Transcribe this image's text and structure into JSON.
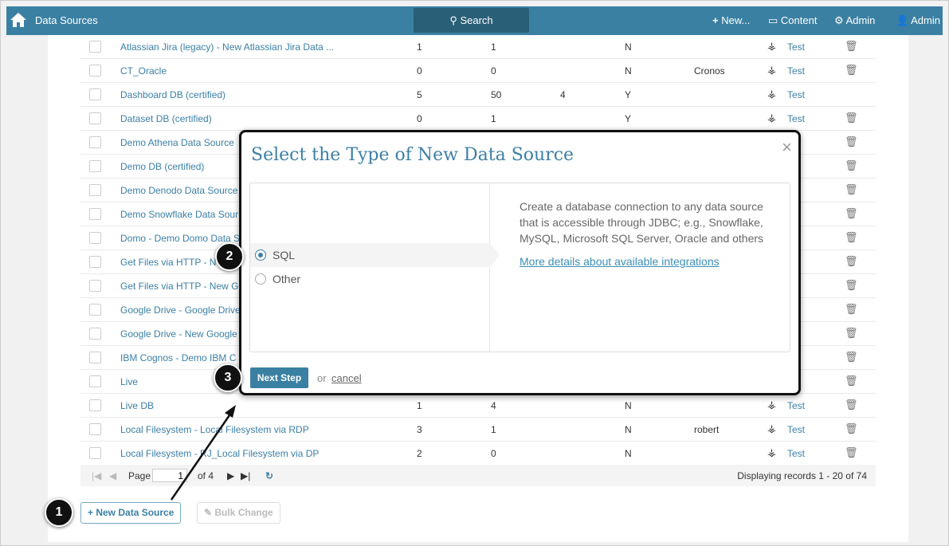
{
  "header": {
    "title": "Data Sources",
    "search": "Search",
    "new": "New...",
    "content": "Content",
    "admin_settings": "Admin",
    "user": "Admin"
  },
  "rows": [
    {
      "name": "Atlassian Jira (legacy) - New Atlassian Jira Data ...",
      "c1": "1",
      "c2": "1",
      "c3": "",
      "c4": "N",
      "c5": "",
      "test": "Test",
      "trash": true
    },
    {
      "name": "CT_Oracle",
      "c1": "0",
      "c2": "0",
      "c3": "",
      "c4": "N",
      "c5": "Cronos",
      "test": "Test",
      "trash": true
    },
    {
      "name": "Dashboard DB (certified)",
      "c1": "5",
      "c2": "50",
      "c3": "4",
      "c4": "Y",
      "c5": "",
      "test": "Test",
      "trash": false
    },
    {
      "name": "Dataset DB (certified)",
      "c1": "0",
      "c2": "1",
      "c3": "",
      "c4": "Y",
      "c5": "",
      "test": "Test",
      "trash": true
    },
    {
      "name": "Demo Athena Data Source",
      "trash": true
    },
    {
      "name": "Demo DB (certified)",
      "trash": true
    },
    {
      "name": "Demo Denodo Data Source",
      "trash": true
    },
    {
      "name": "Demo Snowflake Data Sour",
      "trash": true
    },
    {
      "name": "Domo - Demo Domo Data S",
      "trash": true
    },
    {
      "name": "Get Files via HTTP - N",
      "trash": true
    },
    {
      "name": "Get Files via HTTP - New G",
      "trash": true
    },
    {
      "name": "Google Drive - Google Drive",
      "trash": true
    },
    {
      "name": "Google Drive - New Google",
      "trash": true
    },
    {
      "name": "IBM Cognos - Demo IBM C",
      "trash": true
    },
    {
      "name": "Live",
      "trash": true
    },
    {
      "name": "Live DB",
      "c1": "1",
      "c2": "4",
      "c3": "",
      "c4": "N",
      "c5": "",
      "test": "Test",
      "trash": true
    },
    {
      "name": "Local Filesystem - Local Filesystem via RDP",
      "c1": "3",
      "c2": "1",
      "c3": "",
      "c4": "N",
      "c5": "robert",
      "test": "Test",
      "trash": true
    },
    {
      "name": "Local Filesystem - RJ_Local Filesystem via DP",
      "c1": "2",
      "c2": "0",
      "c3": "",
      "c4": "N",
      "c5": "",
      "test": "Test",
      "trash": true
    }
  ],
  "pager": {
    "page_label": "Page",
    "page": "1",
    "of": "of 4",
    "display": "Displaying records 1 - 20 of 74"
  },
  "buttons": {
    "new_ds": "New Data Source",
    "bulk": "Bulk Change"
  },
  "modal": {
    "title": "Select the Type of New Data Source",
    "options": [
      "SQL",
      "Other"
    ],
    "selected": "SQL",
    "description": "Create a database connection to any data source that is accessible through JDBC; e.g., Snowflake, MySQL, Microsoft SQL Server, Oracle and others",
    "link": "More details about available integrations",
    "next": "Next Step",
    "or": "or",
    "cancel": "cancel",
    "close": "×"
  },
  "callouts": [
    "1",
    "2",
    "3"
  ],
  "colors": {
    "header": "#3a80a2",
    "accent": "#3a7fa6"
  }
}
